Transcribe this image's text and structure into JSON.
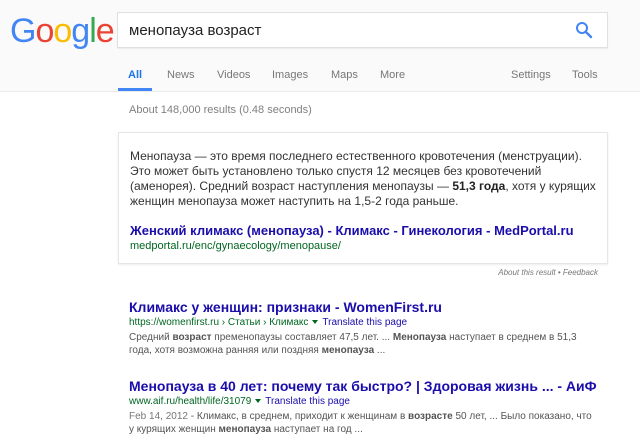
{
  "logo": {
    "letters": [
      "G",
      "o",
      "o",
      "g",
      "l",
      "e"
    ],
    "colors": [
      "#4285f4",
      "#ea4335",
      "#fbbc05",
      "#4285f4",
      "#34a853",
      "#ea4335"
    ]
  },
  "search": {
    "query": "менопауза возраст",
    "icon": "search-icon"
  },
  "tabs": {
    "all": "All",
    "news": "News",
    "videos": "Videos",
    "images": "Images",
    "maps": "Maps",
    "more": "More",
    "settings": "Settings",
    "tools": "Tools"
  },
  "stats": "About 148,000 results (0.48 seconds)",
  "featured": {
    "text_before": "Менопауза — это время последнего естественного кровотечения (менструации). Это может быть установлено только спустя 12 месяцев без кровотечений (аменорея). Средний возраст наступления менопаузы — ",
    "text_bold": "51,3 года",
    "text_after": ", хотя у курящих женщин менопауза может наступить на 1,5-2 года раньше.",
    "title": "Женский климакс (менопауза) - Климакс - Гинекология - MedPortal.ru",
    "url": "medportal.ru/enc/gynaecology/menopause/"
  },
  "about_result": "About this result • Feedback",
  "results": [
    {
      "title": "Климакс у женщин: признаки - WomenFirst.ru",
      "url": "https://womenfirst.ru › Статьи › Климакс",
      "translate": "Translate this page",
      "snippet": {
        "p1": "Средний ",
        "b1": "возраст",
        "p2": " пременопаузы составляет 47,5 лет. ... ",
        "b2": "Менопауза",
        "p3": " наступает в среднем в 51,3 года, хотя возможна ранняя или поздняя ",
        "b3": "менопауза",
        "p4": " ..."
      }
    },
    {
      "title": "Менопауза в 40 лет: почему так быстро? | Здоровая жизнь ... - АиФ",
      "url": "www.aif.ru/health/life/31079",
      "translate": "Translate this page",
      "snippet": {
        "date": "Feb 14, 2012",
        "p1": " - Климакс, в среднем, приходит к женщинам в ",
        "b1": "возрасте",
        "p2": " 50 лет, ... Было показано, что у курящих женщин ",
        "b2": "менопауза",
        "p3": " наступает на год ..."
      }
    }
  ]
}
